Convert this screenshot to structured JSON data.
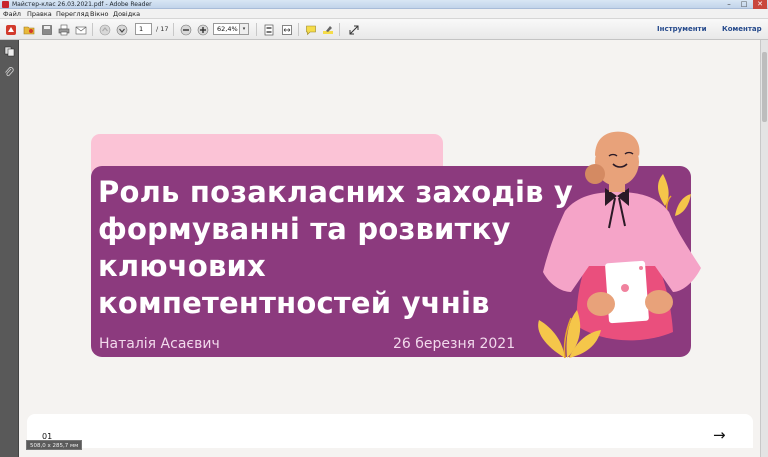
{
  "window": {
    "title": "Майстер-клас 26.03.2021.pdf - Adobe Reader",
    "minimize": "–",
    "maximize": "□",
    "close": "✕"
  },
  "menu": [
    "Файл",
    "Правка",
    "Перегляд",
    "Вікно",
    "Довідка"
  ],
  "toolbar": {
    "page_current": "1",
    "page_total": "/ 17",
    "zoom_value": "62,4%",
    "dropdown_glyph": "▾",
    "tools_label": "Інструменти",
    "comment_label": "Коментар"
  },
  "slide": {
    "title_lines": [
      "Роль позакласних заходів у",
      "формуванні та розвитку",
      "ключових",
      "компетентностей учнів"
    ],
    "author": "Наталія Асаєвич",
    "date": "26 березня 2021"
  },
  "next_slide": {
    "number": "01",
    "arrow": "→"
  },
  "status": {
    "page_size": "508,0 x 285,7 мм"
  },
  "colors": {
    "card": "#8c3a7e",
    "pink_tab": "#fbc3d6",
    "page_bg": "#f5f3f1",
    "frame_green": "#5a9a3c",
    "link_blue": "#264a8c"
  },
  "icons": [
    "acrobat-app-icon",
    "create-pdf-icon",
    "open-icon",
    "save-icon",
    "print-icon",
    "email-icon",
    "page-up-icon",
    "page-down-icon",
    "zoom-out-icon",
    "zoom-in-icon",
    "fit-page-icon",
    "fit-width-icon",
    "comment-icon",
    "highlight-icon",
    "expand-icon",
    "pages-panel-icon",
    "attachments-icon"
  ]
}
